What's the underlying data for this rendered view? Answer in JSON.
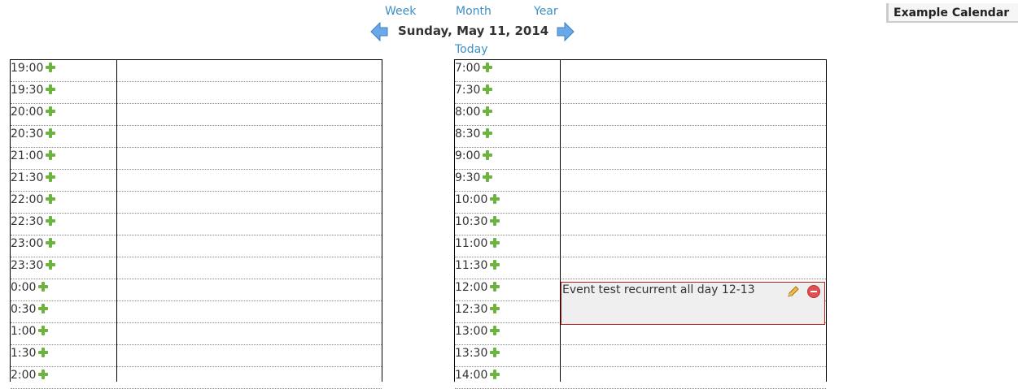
{
  "nav": {
    "week": "Week",
    "month": "Month",
    "year": "Year",
    "today": "Today"
  },
  "date_title": "Sunday, May 11, 2014",
  "calendar_name": "Example Calendar",
  "left_times": [
    "19:00",
    "19:30",
    "20:00",
    "20:30",
    "21:00",
    "21:30",
    "22:00",
    "22:30",
    "23:00",
    "23:30",
    "0:00",
    "0:30",
    "1:00",
    "1:30",
    "2:00"
  ],
  "right_times": [
    "7:00",
    "7:30",
    "8:00",
    "8:30",
    "9:00",
    "9:30",
    "10:00",
    "10:30",
    "11:00",
    "11:30",
    "12:00",
    "12:30",
    "13:00",
    "13:30",
    "14:00"
  ],
  "event": {
    "title": "Event test recurrent all day 12-13"
  },
  "colors": {
    "link": "#3d8fc6",
    "add": "#6cb33f",
    "event_border": "#b22222",
    "event_bg": "#efefef"
  }
}
